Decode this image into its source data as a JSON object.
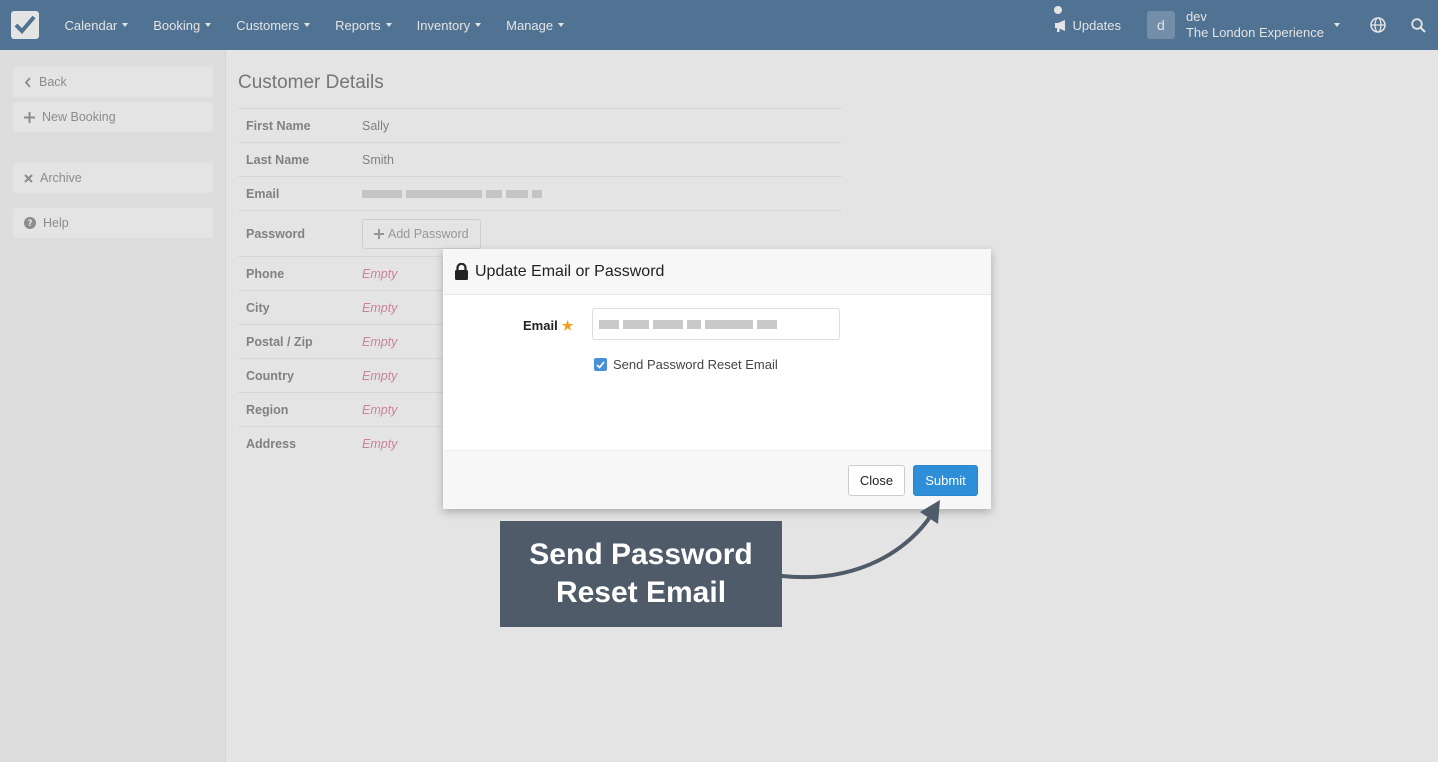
{
  "nav": {
    "items": [
      {
        "label": "Calendar"
      },
      {
        "label": "Booking"
      },
      {
        "label": "Customers"
      },
      {
        "label": "Reports"
      },
      {
        "label": "Inventory"
      },
      {
        "label": "Manage"
      }
    ],
    "updates_label": "Updates",
    "user_initial": "d",
    "user_name": "dev",
    "company": "The London Experience"
  },
  "sidebar": {
    "back": "Back",
    "new_booking": "New Booking",
    "archive": "Archive",
    "help": "Help"
  },
  "customer": {
    "title": "Customer Details",
    "rows": [
      {
        "label": "First Name",
        "value": "Sally"
      },
      {
        "label": "Last Name",
        "value": "Smith"
      },
      {
        "label": "Email",
        "value": ""
      },
      {
        "label": "Password",
        "button": "Add Password"
      },
      {
        "label": "Phone",
        "value": "Empty"
      },
      {
        "label": "City",
        "value": "Empty"
      },
      {
        "label": "Postal / Zip",
        "value": "Empty"
      },
      {
        "label": "Country",
        "value": "Empty"
      },
      {
        "label": "Region",
        "value": "Empty"
      },
      {
        "label": "Address",
        "value": "Empty"
      }
    ]
  },
  "modal": {
    "title": "Update Email or Password",
    "email_label": "Email",
    "email_value": "",
    "checkbox_label": "Send Password Reset Email",
    "checkbox_checked": true,
    "close_label": "Close",
    "submit_label": "Submit"
  },
  "callout": {
    "line1": "Send Password",
    "line2": "Reset Email"
  },
  "colors": {
    "navbar": "#1a4f82",
    "submit": "#2e8fd8",
    "callout": "#4f5b69",
    "empty_text": "#d66a8a",
    "required_star": "#f0a020"
  }
}
